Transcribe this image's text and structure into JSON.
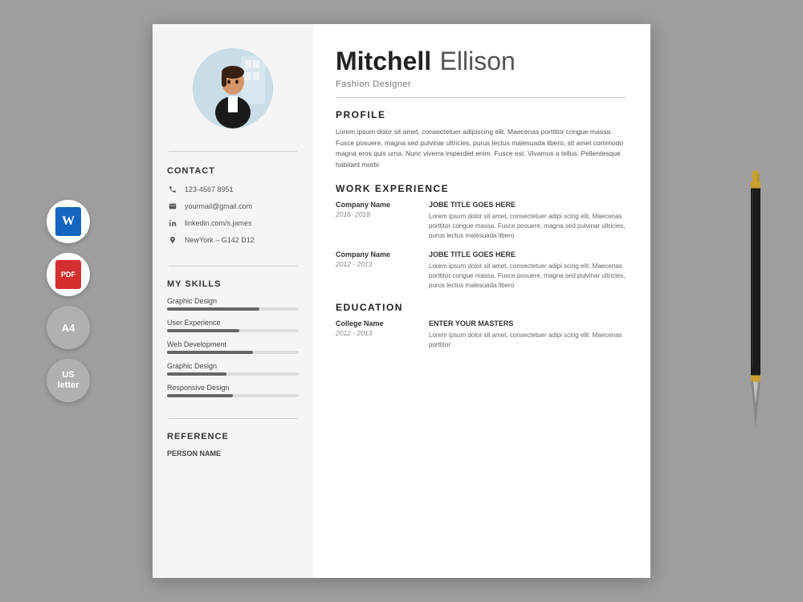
{
  "background_color": "#9e9e9e",
  "left_icons": [
    {
      "id": "word",
      "label": "W",
      "type": "word"
    },
    {
      "id": "pdf",
      "label": "PDF",
      "type": "pdf"
    },
    {
      "id": "a4",
      "label": "A4",
      "type": "size"
    },
    {
      "id": "us",
      "label": "US\nletter",
      "type": "size"
    }
  ],
  "resume": {
    "sidebar": {
      "contact_title": "CONTACT",
      "phone": "123-4567 8951",
      "email": "yourmail@gmail.com",
      "linkedin": "linkedin.com/s.james",
      "address": "NewYork – G142 D12",
      "skills_title": "MY SKILLS",
      "skills": [
        {
          "name": "Graphic Design",
          "percent": 70
        },
        {
          "name": "User Experience",
          "percent": 55
        },
        {
          "name": "Web Development",
          "percent": 65
        },
        {
          "name": "Graphic Design",
          "percent": 45
        },
        {
          "name": "Responsive Design",
          "percent": 50
        }
      ],
      "reference_title": "REFERENCE",
      "reference_sub": "PERSON NAME"
    },
    "main": {
      "first_name": "Mitchell",
      "last_name": "Ellison",
      "job_title": "Fashion Designer",
      "profile_title": "PROFILE",
      "profile_text": "Lorem ipsum dolor sit amet, consectetuer adipiscing elit. Maecenas porttitor congue massa. Fusce posuere, magna sed pulvinar ultricies, purus lectus malesuada libero, sit amet commodo magna eros quis urna. Nunc viverra imperdiet enim. Fusce est. Vivamus a tellus. Pellentesque habitant morbi",
      "work_title": "WORK EXPERIENCE",
      "work_entries": [
        {
          "company": "Company Name",
          "dates": "2016- 2018",
          "job_title": "JOBE TITLE GOES HERE",
          "desc": "Lorem ipsum dolor sit amet, consectetuer adipi scing elit. Maecenas porttitor congue massa. Fusce posuere, magna sed pulvinar ultricies, purus lectus malesuada libero"
        },
        {
          "company": "Company Name",
          "dates": "2012 - 2013",
          "job_title": "JOBE TITLE GOES HERE",
          "desc": "Lorem ipsum dolor sit amet, consectetuer adipi scing elit. Maecenas porttitor congue massa. Fusce posuere, magna sed pulvinar ultricies, purus lectus malesuada libero"
        }
      ],
      "education_title": "EDUCATION",
      "edu_entries": [
        {
          "college": "College Name",
          "dates": "2012 - 2013",
          "degree": "ENTER YOUR MASTERS",
          "desc": "Lorem ipsum dolor sit amet, consectetuer adipi scing elit. Maecenas porttitor"
        }
      ]
    }
  }
}
